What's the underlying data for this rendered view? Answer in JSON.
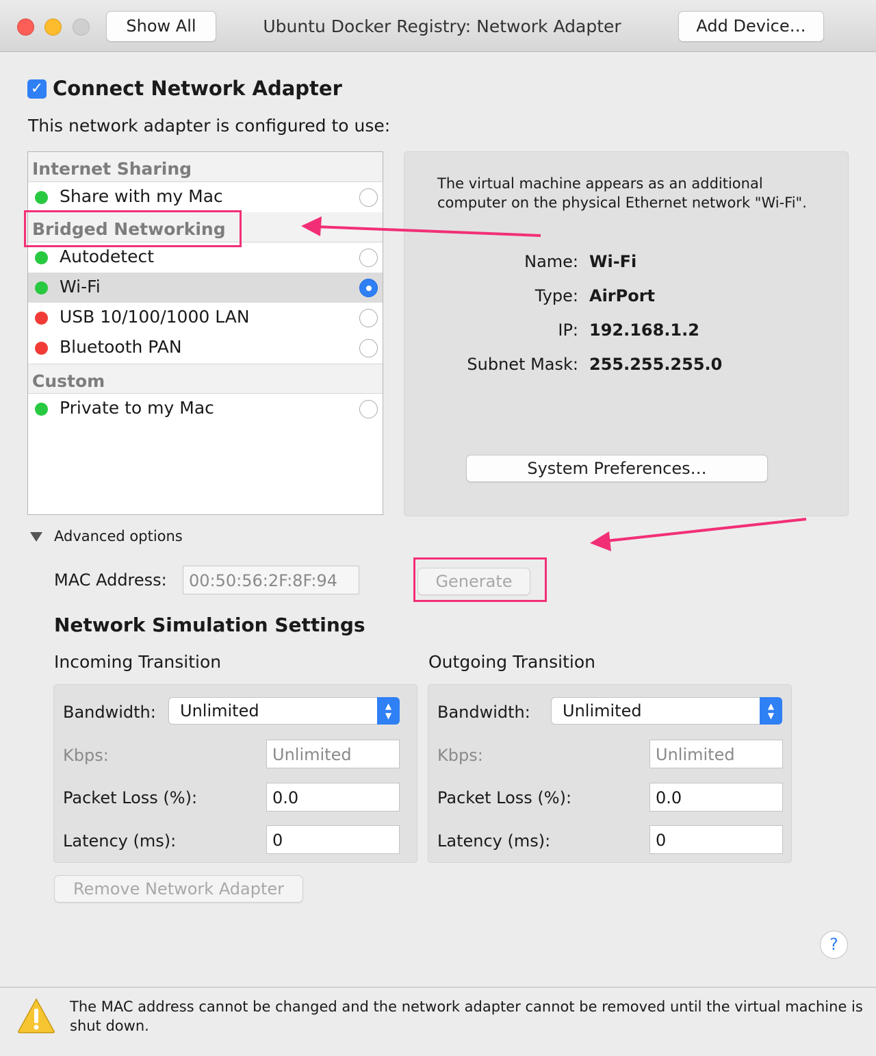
{
  "window": {
    "title": "Ubuntu Docker Registry: Network Adapter",
    "show_all": "Show All",
    "add_device": "Add Device…"
  },
  "connect": {
    "label": "Connect Network Adapter",
    "checked": true,
    "configured_text": "This network adapter is configured to use:"
  },
  "network_list": {
    "groups": [
      {
        "title": "Internet Sharing",
        "items": [
          {
            "label": "Share with my Mac",
            "status": "green",
            "selected": false
          }
        ]
      },
      {
        "title": "Bridged Networking",
        "items": [
          {
            "label": "Autodetect",
            "status": "green",
            "selected": false
          },
          {
            "label": "Wi-Fi",
            "status": "green",
            "selected": true
          },
          {
            "label": "USB 10/100/1000 LAN",
            "status": "red",
            "selected": false
          },
          {
            "label": "Bluetooth PAN",
            "status": "red",
            "selected": false
          }
        ]
      },
      {
        "title": "Custom",
        "items": [
          {
            "label": "Private to my Mac",
            "status": "green",
            "selected": false
          }
        ]
      }
    ]
  },
  "info": {
    "description": "The virtual machine appears as an additional computer on the physical Ethernet network \"Wi-Fi\".",
    "name_key": "Name:",
    "name_val": "Wi-Fi",
    "type_key": "Type:",
    "type_val": "AirPort",
    "ip_key": "IP:",
    "ip_val": "192.168.1.2",
    "mask_key": "Subnet Mask:",
    "mask_val": "255.255.255.0",
    "sysprefs": "System Preferences…"
  },
  "advanced": {
    "label": "Advanced options",
    "mac_label": "MAC Address:",
    "mac_value": "00:50:56:2F:8F:94",
    "generate": "Generate"
  },
  "simulation": {
    "title": "Network Simulation Settings",
    "incoming": {
      "title": "Incoming Transition",
      "bandwidth_label": "Bandwidth:",
      "bandwidth_value": "Unlimited",
      "kbps_label": "Kbps:",
      "kbps_value": "Unlimited",
      "loss_label": "Packet Loss (%):",
      "loss_value": "0.0",
      "latency_label": "Latency (ms):",
      "latency_value": "0"
    },
    "outgoing": {
      "title": "Outgoing Transition",
      "bandwidth_label": "Bandwidth:",
      "bandwidth_value": "Unlimited",
      "kbps_label": "Kbps:",
      "kbps_value": "Unlimited",
      "loss_label": "Packet Loss (%):",
      "loss_value": "0.0",
      "latency_label": "Latency (ms):",
      "latency_value": "0"
    }
  },
  "remove_button": "Remove Network Adapter",
  "help": "?",
  "footer": {
    "warning": "The MAC address cannot be changed and the network adapter cannot be removed until the virtual machine is shut down."
  },
  "colors": {
    "accent": "#2f7ff5",
    "annotation": "#f22f76",
    "status_green": "#28c940",
    "status_red": "#f23b36"
  }
}
